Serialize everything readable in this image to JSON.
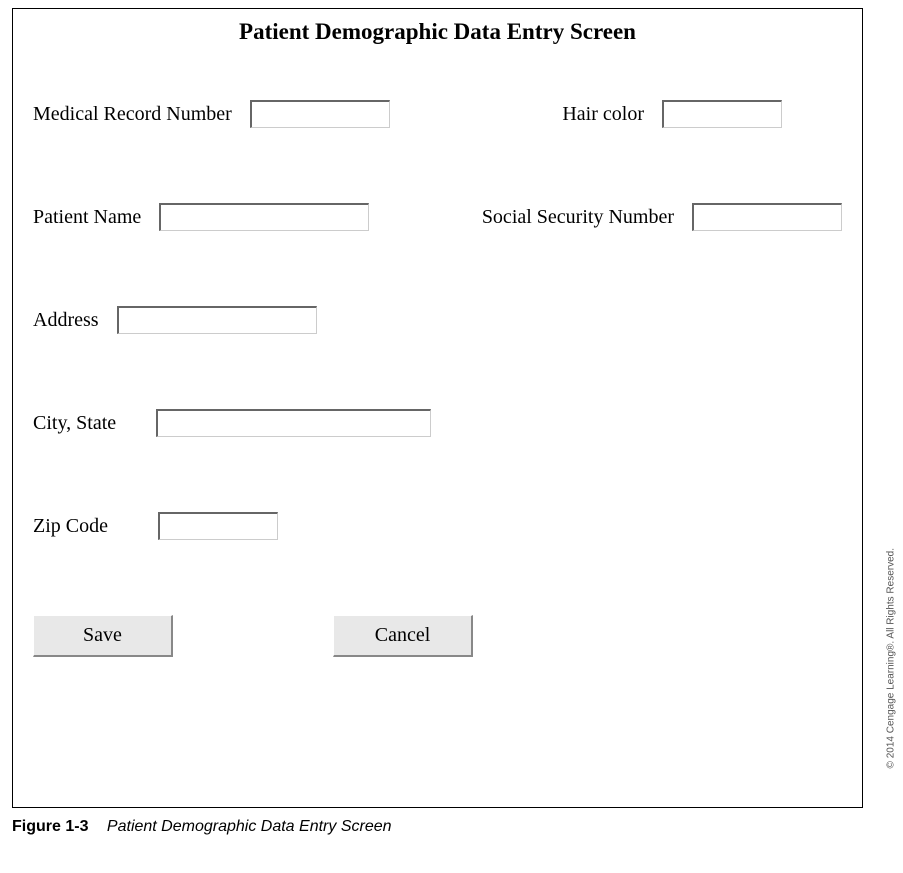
{
  "title": "Patient Demographic Data Entry Screen",
  "fields": {
    "mrn": {
      "label": "Medical Record Number",
      "value": ""
    },
    "hair_color": {
      "label": "Hair color",
      "value": ""
    },
    "patient_name": {
      "label": "Patient Name",
      "value": ""
    },
    "ssn": {
      "label": "Social Security Number",
      "value": ""
    },
    "address": {
      "label": "Address",
      "value": ""
    },
    "city_state": {
      "label": "City, State",
      "value": ""
    },
    "zip": {
      "label": "Zip Code",
      "value": ""
    }
  },
  "buttons": {
    "save": "Save",
    "cancel": "Cancel"
  },
  "copyright": "© 2014 Cengage Learning®. All Rights Reserved.",
  "figure": {
    "number": "Figure 1-3",
    "title": "Patient Demographic Data Entry Screen"
  }
}
